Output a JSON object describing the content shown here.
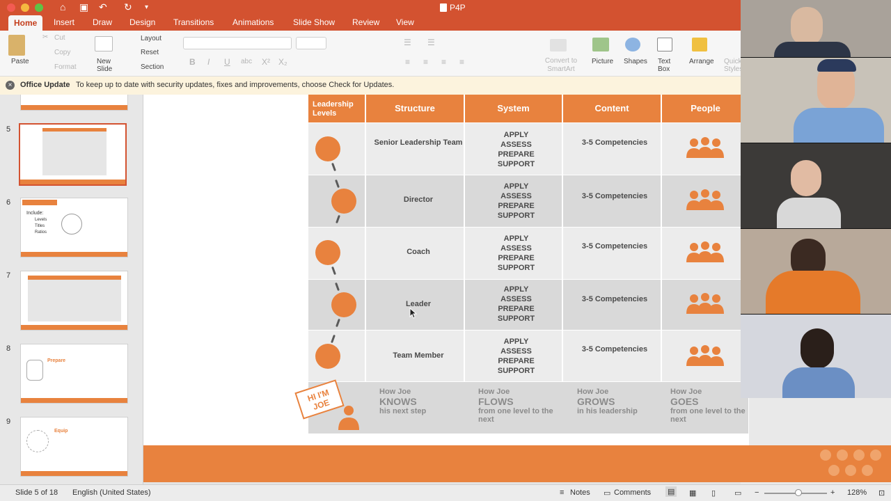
{
  "window": {
    "title": "P4P"
  },
  "tabs": [
    "Home",
    "Insert",
    "Draw",
    "Design",
    "Transitions",
    "Animations",
    "Slide Show",
    "Review",
    "View"
  ],
  "ribbon": {
    "paste": "Paste",
    "cut": "Cut",
    "copy": "Copy",
    "format": "Format",
    "new_slide": "New Slide",
    "layout": "Layout",
    "reset": "Reset",
    "section": "Section",
    "convert": "Convert to SmartArt",
    "picture": "Picture",
    "shapes": "Shapes",
    "text_box": "Text Box",
    "arrange": "Arrange",
    "quick_styles": "Quick Styles"
  },
  "notice": {
    "title": "Office Update",
    "message": "To keep up to date with security updates, fixes and improvements, choose Check for Updates."
  },
  "thumbnails": [
    "5",
    "6",
    "7",
    "8",
    "9"
  ],
  "thumb_text": {
    "include": "Include:",
    "levels": "Levels",
    "titles": "Titles",
    "ratios": "Ratios",
    "prepare": "Prepare",
    "equip": "Equip"
  },
  "slide": {
    "headers": [
      "Leadership Levels",
      "Structure",
      "System",
      "Content",
      "People"
    ],
    "rows": [
      {
        "level": "Senior Leadership Team",
        "system": [
          "APPLY",
          "ASSESS",
          "PREPARE",
          "SUPPORT"
        ],
        "content": "3-5 Competencies"
      },
      {
        "level": "Director",
        "system": [
          "APPLY",
          "ASSESS",
          "PREPARE",
          "SUPPORT"
        ],
        "content": "3-5 Competencies"
      },
      {
        "level": "Coach",
        "system": [
          "APPLY",
          "ASSESS",
          "PREPARE",
          "SUPPORT"
        ],
        "content": "3-5 Competencies"
      },
      {
        "level": "Leader",
        "system": [
          "APPLY",
          "ASSESS",
          "PREPARE",
          "SUPPORT"
        ],
        "content": "3-5 Competencies"
      },
      {
        "level": "Team Member",
        "system": [
          "APPLY",
          "ASSESS",
          "PREPARE",
          "SUPPORT"
        ],
        "content": "3-5 Competencies"
      }
    ],
    "badge": "HI I'M JOE",
    "footer": [
      {
        "pre": "How Joe",
        "big": "KNOWS",
        "post": "his next step"
      },
      {
        "pre": "How Joe",
        "big": "FLOWS",
        "post": "from one level to the next"
      },
      {
        "pre": "How Joe",
        "big": "GROWS",
        "post": "in his leadership"
      },
      {
        "pre": "How Joe",
        "big": "GOES",
        "post": "from one level to the next"
      }
    ]
  },
  "status": {
    "slide": "Slide 5 of 18",
    "language": "English (United States)",
    "notes": "Notes",
    "comments": "Comments",
    "zoom": "128%"
  },
  "colors": {
    "accent": "#e8823e",
    "ribbon_red": "#d35230"
  }
}
